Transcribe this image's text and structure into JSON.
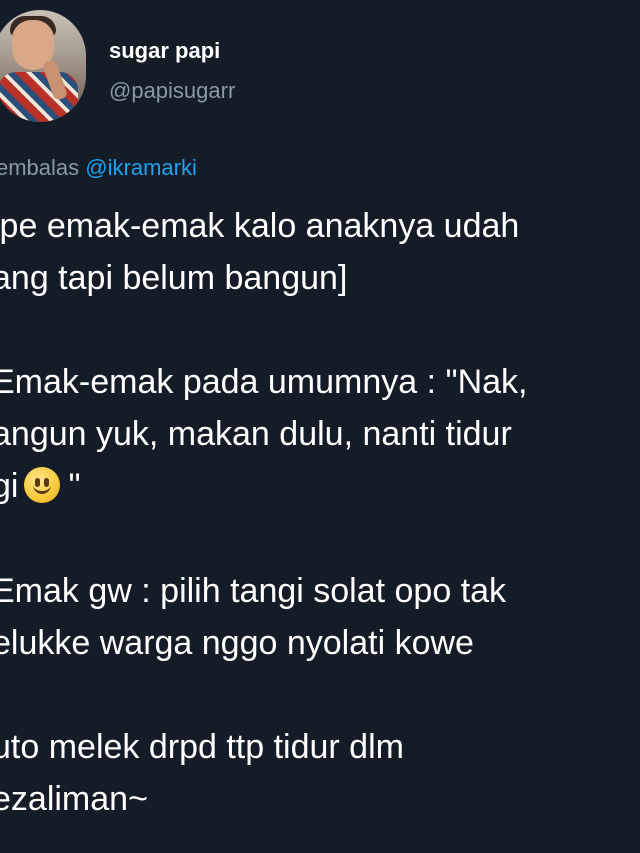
{
  "user": {
    "display_name": "sugar papi",
    "handle": "@papisugarr"
  },
  "reply": {
    "prefix": "embalas",
    "mention": "@ikramarki"
  },
  "body": {
    "lines": [
      "ipe emak-emak kalo anaknya udah",
      "ang tapi belum bangun]",
      "Emak-emak pada umumnya : \"Nak,",
      "angun yuk, makan dulu, nanti tidur",
      "gi",
      "\"",
      "Emak gw : pilih tangi solat opo tak",
      "elukke warga nggo nyolati kowe",
      "uto melek drpd ttp tidur dlm",
      "ezaliman~"
    ],
    "emoji": "slightly-smiling-face-icon"
  },
  "colors": {
    "background": "#15202b",
    "text": "#ffffff",
    "secondary": "#8899a6",
    "link": "#1da1f2"
  }
}
